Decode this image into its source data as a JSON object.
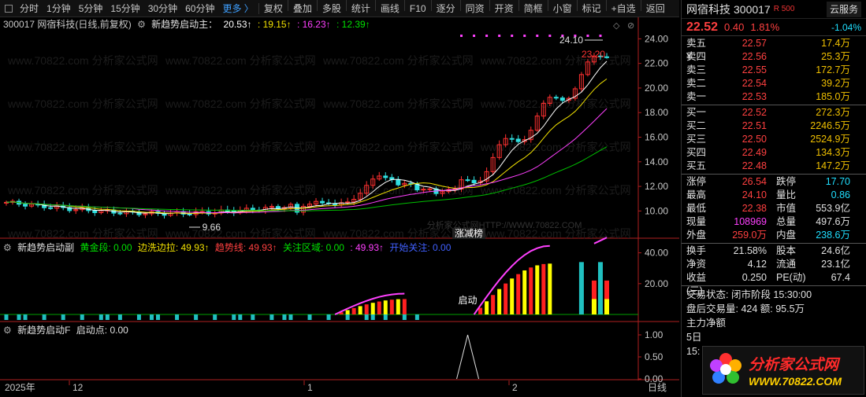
{
  "toolbar": {
    "period_tabs": [
      "分时",
      "1分钟",
      "5分钟",
      "15分钟",
      "30分钟",
      "60分钟"
    ],
    "more": "更多 〉",
    "actions": [
      "复权",
      "叠加",
      "多股",
      "统计",
      "画线",
      "F10",
      "逐分",
      "同资",
      "开资",
      "简框",
      "小窗",
      "标记",
      "+自选",
      "返回"
    ]
  },
  "main_chart": {
    "title": "300017 网宿科技(日线,前复权)",
    "indicator_name": "新趋势启动主：",
    "values": [
      {
        "text": "20.53↑",
        "color": "#ffffff"
      },
      {
        "text": ": 19.15↑",
        "color": "#f0e000"
      },
      {
        "text": ": 16.23↑",
        "color": "#ff40ff"
      },
      {
        "text": ": 12.39↑",
        "color": "#00e000"
      }
    ],
    "high_label": "24.10",
    "low_label": "9.66",
    "last_label": "23.20",
    "limit_label": "涨减榜",
    "y_ticks": [
      "24.00",
      "22.00",
      "20.00",
      "18.00",
      "16.00",
      "14.00",
      "12.00",
      "10.00"
    ]
  },
  "sub1": {
    "title": "新趋势启动副",
    "items": [
      {
        "text": "黄金段: 0.00",
        "color": "#00e000"
      },
      {
        "text": "边洗边拉: 49.93↑",
        "color": "#f0e000"
      },
      {
        "text": "趋势线: 49.93↑",
        "color": "#ff4040"
      },
      {
        "text": "关注区域: 0.00",
        "color": "#00e000"
      },
      {
        "text": ": 49.93↑",
        "color": "#ff40ff"
      },
      {
        "text": "开始关注: 0.00",
        "color": "#4060ff"
      }
    ],
    "start_label": "启动",
    "y_ticks": [
      "40.00",
      "20.00"
    ]
  },
  "sub2": {
    "title": "新趋势启动F",
    "items": [
      {
        "text": "启动点: 0.00",
        "color": "#e0e0e0"
      }
    ],
    "y_ticks": [
      "1.00",
      "0.50",
      "0.00"
    ]
  },
  "x_axis": {
    "labels": [
      {
        "text": "2025年",
        "pos": "left"
      },
      {
        "text": "12",
        "pos": "dec"
      },
      {
        "text": "1",
        "pos": "jan"
      },
      {
        "text": "2",
        "pos": "feb"
      }
    ],
    "period": "日线"
  },
  "watermark": "www.70822.com 分析家公式网",
  "watermark_center": "分析家公式网HTTP://WWW.70822.COM",
  "panel": {
    "name": "网宿科技",
    "code": "300017",
    "rbadge": "R 500",
    "cloud": "云服务",
    "price": "22.52",
    "change": "0.40",
    "pct": "1.81%",
    "cloud_pct": "-1.04%",
    "asks": [
      {
        "label": "卖五 ¥",
        "price": "22.57",
        "vol": "17.4万"
      },
      {
        "label": "卖四",
        "price": "22.56",
        "vol": "25.3万"
      },
      {
        "label": "卖三",
        "price": "22.55",
        "vol": "172.7万"
      },
      {
        "label": "卖二",
        "price": "22.54",
        "vol": "39.2万"
      },
      {
        "label": "卖一",
        "price": "22.53",
        "vol": "185.0万"
      }
    ],
    "bids": [
      {
        "label": "买一",
        "price": "22.52",
        "vol": "272.3万"
      },
      {
        "label": "买二",
        "price": "22.51",
        "vol": "2246.5万"
      },
      {
        "label": "买三",
        "price": "22.50",
        "vol": "2524.9万"
      },
      {
        "label": "买四",
        "price": "22.49",
        "vol": "134.3万"
      },
      {
        "label": "买五",
        "price": "22.48",
        "vol": "147.2万"
      }
    ],
    "stats_a": [
      {
        "l1": "涨停",
        "v1": "26.54",
        "c1": "c-red",
        "l2": "跌停",
        "v2": "17.70",
        "c2": "c-cyan"
      },
      {
        "l1": "最高",
        "v1": "24.10",
        "c1": "c-red",
        "l2": "量比",
        "v2": "0.86",
        "c2": "c-cyan"
      },
      {
        "l1": "最低",
        "v1": "22.38",
        "c1": "c-red",
        "l2": "市值",
        "v2": "553.9亿",
        "c2": "c-white"
      },
      {
        "l1": "现量",
        "v1": "108969",
        "c1": "c-mag",
        "l2": "总量",
        "v2": "497.6万",
        "c2": "c-white"
      },
      {
        "l1": "外盘",
        "v1": "259.0万",
        "c1": "c-red",
        "l2": "内盘",
        "v2": "238.6万",
        "c2": "c-cyan"
      }
    ],
    "stats_b": [
      {
        "l1": "换手",
        "v1": "21.58%",
        "c1": "c-white",
        "l2": "股本",
        "v2": "24.6亿",
        "c2": "c-white"
      },
      {
        "l1": "净资",
        "v1": "4.12",
        "c1": "c-white",
        "l2": "流通",
        "v2": "23.1亿",
        "c2": "c-white"
      },
      {
        "l1": "收益(三)",
        "v1": "0.250",
        "c1": "c-white",
        "l2": "PE(动)",
        "v2": "67.4",
        "c2": "c-white"
      }
    ],
    "status_line": "交易状态: 闭市阶段 15:30:00",
    "after_line": "盘后交易量: 424  额: 95.5万",
    "cut_line1": "主力净额",
    "cut_line2": "5日",
    "cut_line3": "15:"
  },
  "logo": {
    "line1": "分析家公式网",
    "line2": "WWW.70822.COM"
  }
}
